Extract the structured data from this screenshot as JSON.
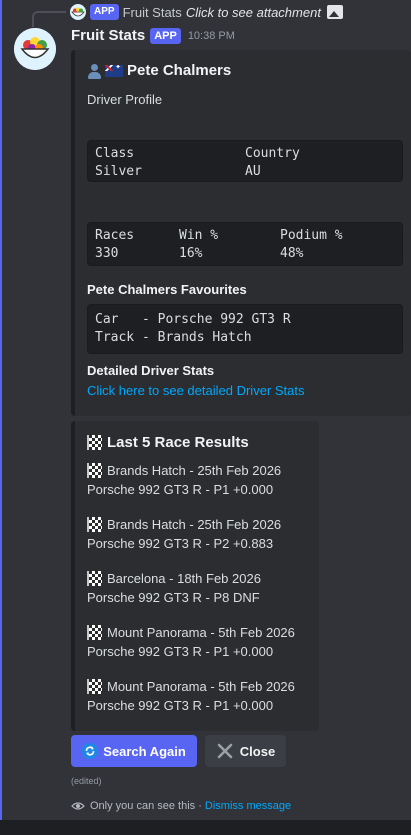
{
  "reply": {
    "badge": "APP",
    "author": "Fruit Stats",
    "text": "Click to see attachment"
  },
  "message": {
    "author": "Fruit Stats",
    "badge": "APP",
    "time": "10:38 PM"
  },
  "profile": {
    "name": "Pete Chalmers",
    "subtitle": "Driver Profile",
    "class_header": "Class",
    "country_header": "Country",
    "class_value": "Silver",
    "country_value": "AU",
    "races_header": "Races",
    "win_header": "Win %",
    "podium_header": "Podium %",
    "races_value": "330",
    "win_value": "16%",
    "podium_value": "48%",
    "favourites_title": "Pete Chalmers Favourites",
    "fav_car": "Car   - Porsche 992 GT3 R",
    "fav_track": "Track - Brands Hatch",
    "detailed_title": "Detailed Driver Stats",
    "detailed_link": "Click here to see detailed Driver Stats"
  },
  "results": {
    "title": "Last 5 Race Results",
    "items": [
      {
        "line1": "Brands Hatch - 25th Feb 2026",
        "line2": "Porsche 992 GT3 R - P1 +0.000"
      },
      {
        "line1": "Brands Hatch - 25th Feb 2026",
        "line2": "Porsche 992 GT3 R - P2 +0.883"
      },
      {
        "line1": "Barcelona - 18th Feb 2026",
        "line2": "Porsche 992 GT3 R - P8 DNF"
      },
      {
        "line1": "Mount Panorama - 5th Feb 2026",
        "line2": "Porsche 992 GT3 R - P1 +0.000"
      },
      {
        "line1": "Mount Panorama - 5th Feb 2026",
        "line2": "Porsche 992 GT3 R - P1 +0.000"
      }
    ]
  },
  "buttons": {
    "search_again": "Search Again",
    "close": "Close"
  },
  "footer": {
    "edited": "(edited)",
    "only_you": "Only you can see this ·",
    "dismiss": "Dismiss message"
  },
  "colors": {
    "accent": "#5865f2",
    "link": "#00a8fc",
    "background": "#323339",
    "embed": "#2b2d31"
  },
  "icons": {
    "avatar": "fruit-bowl-icon",
    "profile": "person-icon",
    "flag": "australia-flag-icon",
    "race": "checkered-flag-icon",
    "search_again": "refresh-icon",
    "close": "x-icon",
    "visibility": "eye-icon",
    "attachment": "image-icon"
  }
}
